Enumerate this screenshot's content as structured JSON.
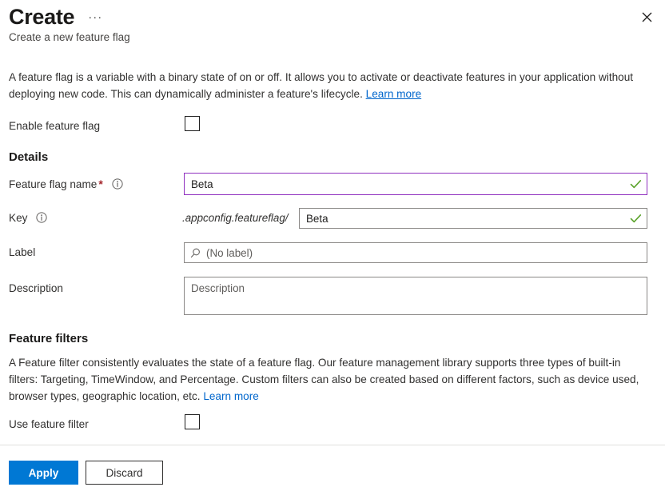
{
  "header": {
    "title": "Create",
    "more_menu": "···",
    "subtitle": "Create a new feature flag",
    "close_icon": "close-icon"
  },
  "intro": {
    "text": "A feature flag is a variable with a binary state of on or off. It allows you to activate or deactivate features in your application without deploying new code. This can dynamically administer a feature's lifecycle. ",
    "link_label": "Learn more"
  },
  "enable_flag": {
    "label": "Enable feature flag",
    "checked": false
  },
  "details": {
    "heading": "Details",
    "flag_name": {
      "label": "Feature flag name",
      "required_marker": "*",
      "info_icon": "info-icon",
      "value": "Beta",
      "validation_icon": "checkmark-icon",
      "focused": true
    },
    "key": {
      "label": "Key",
      "info_icon": "info-icon",
      "prefix": ".appconfig.featureflag/",
      "value": "Beta",
      "validation_icon": "checkmark-icon"
    },
    "flag_label": {
      "label": "Label",
      "search_icon": "search-icon",
      "value": "",
      "placeholder": "(No label)"
    },
    "description": {
      "label": "Description",
      "value": "",
      "placeholder": "Description"
    }
  },
  "feature_filters": {
    "heading": "Feature filters",
    "text": "A Feature filter consistently evaluates the state of a feature flag. Our feature management library supports three types of built-in filters: Targeting, TimeWindow, and Percentage. Custom filters can also be created based on different factors, such as device used, browser types, geographic location, etc. ",
    "link_label": "Learn more",
    "use_filter": {
      "label": "Use feature filter",
      "checked": false
    }
  },
  "footer": {
    "apply_label": "Apply",
    "discard_label": "Discard"
  },
  "colors": {
    "primary": "#0078d4",
    "link": "#0066cc",
    "focus_border": "#8f2fbf",
    "success": "#5ba32b",
    "required": "#a4262c"
  }
}
